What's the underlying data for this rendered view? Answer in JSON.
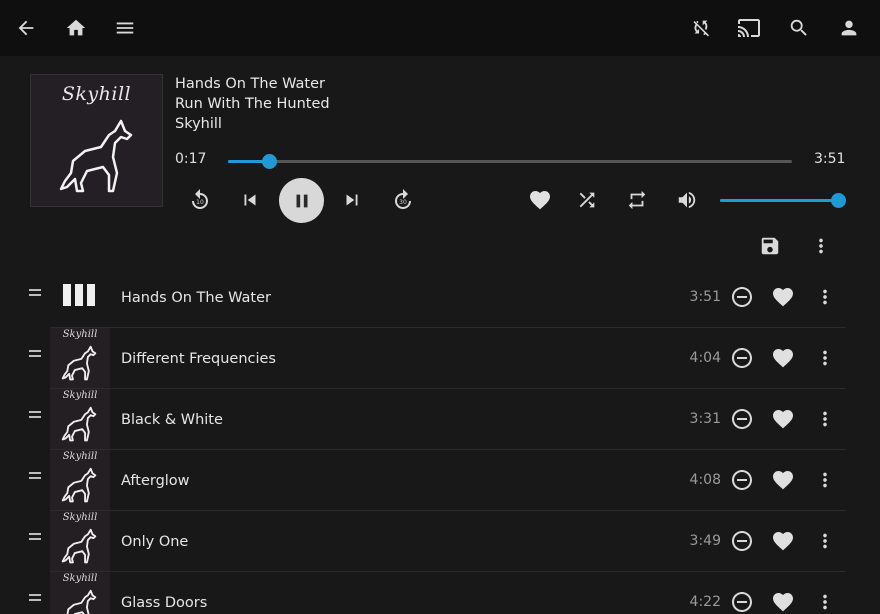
{
  "topbar": {
    "icons": [
      "back-arrow-icon",
      "home-icon",
      "menu-icon",
      "sync-disabled-icon",
      "cast-icon",
      "search-icon",
      "account-icon"
    ]
  },
  "now_playing": {
    "title": "Hands On The Water",
    "album": "Run With The Hunted",
    "artist": "Skyhill",
    "cover_text": "Skyhill",
    "elapsed": "0:17",
    "duration": "3:51",
    "progress_fraction": 0.073,
    "volume_fraction": 1.0,
    "accent_color": "#1e9bd7"
  },
  "queue": {
    "tracks": [
      {
        "title": "Hands On The Water",
        "duration": "3:51",
        "playing": true
      },
      {
        "title": "Different Frequencies",
        "duration": "4:04",
        "playing": false
      },
      {
        "title": "Black & White",
        "duration": "3:31",
        "playing": false
      },
      {
        "title": "Afterglow",
        "duration": "4:08",
        "playing": false
      },
      {
        "title": "Only One",
        "duration": "3:49",
        "playing": false
      },
      {
        "title": "Glass Doors",
        "duration": "4:22",
        "playing": false
      }
    ]
  }
}
